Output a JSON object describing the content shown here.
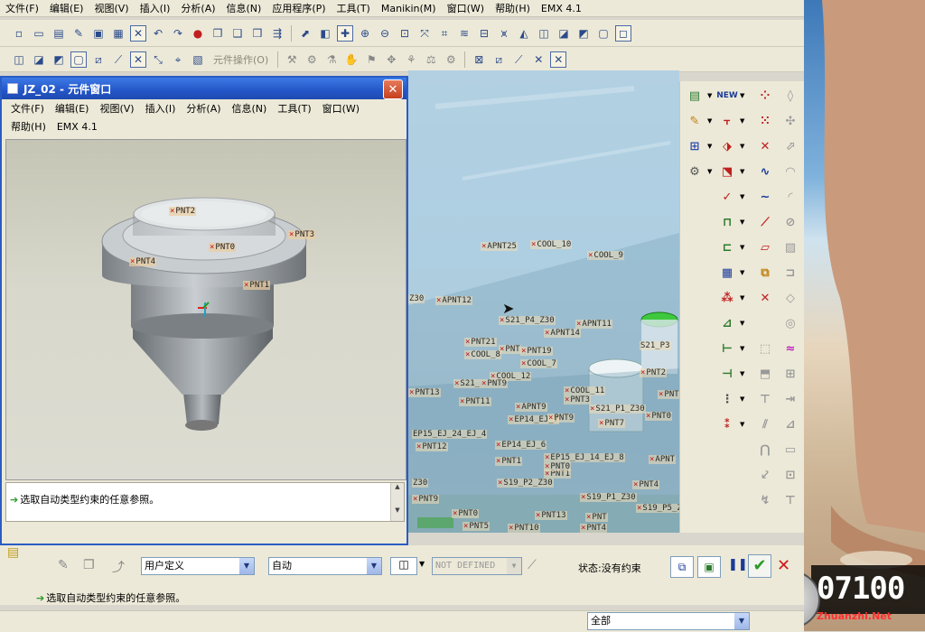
{
  "main_menu": [
    "文件(F)",
    "编辑(E)",
    "视图(V)",
    "插入(I)",
    "分析(A)",
    "信息(N)",
    "应用程序(P)",
    "工具(T)",
    "Manikin(M)",
    "窗口(W)",
    "帮助(H)",
    "EMX 4.1"
  ],
  "toolbar2_label": "元件操作(O)",
  "component_window": {
    "title": "JZ_02 - 元件窗口",
    "menu_row1": [
      "文件(F)",
      "编辑(E)",
      "视图(V)",
      "插入(I)",
      "分析(A)",
      "信息(N)",
      "工具(T)",
      "窗口(W)"
    ],
    "menu_row2": [
      "帮助(H)",
      "EMX 4.1"
    ],
    "points": [
      "PNT2",
      "PNT3",
      "PNT0",
      "PNT4",
      "PNT1"
    ],
    "message": "选取自动类型约束的任意参照。"
  },
  "viewport_labels": [
    "APNT25",
    "COOL_10",
    "COOL_9",
    "APNT12",
    "Z30",
    "S21_P4_Z30",
    "APNT11",
    "APNT14",
    "S21_P3",
    "PNT21",
    "PNT",
    "PNT19",
    "COOL_8",
    "COOL_7",
    "PNT2",
    "COOL_12",
    "S21_",
    "PNT9",
    "PNT13",
    "PNT11",
    "COOL_11",
    "PNT",
    "APNT9",
    "PNT3",
    "S21_P1_Z30",
    "EP14_EJ_7",
    "PNT9",
    "PNT7",
    "PNT0",
    "EP15_EJ_24_EJ_4",
    "PNT12",
    "EP14_EJ_6",
    "EP15_EJ_14_EJ_8",
    "APNT",
    "PNT1",
    "PNT1",
    "PNT0",
    "Z30",
    "S19_P2_Z30",
    "PNT4",
    "PNT9",
    "S19_P1_Z30",
    "PNT0",
    "PNT13",
    "PNT",
    "S19_P5_Z",
    "PNT5",
    "PNT10",
    "PNT4"
  ],
  "dashboard": {
    "constraint_set": "用户定义",
    "constraint_type": "自动",
    "offset": "NOT DEFINED",
    "status": "状态:没有约束"
  },
  "status_message": "选取自动类型约束的任意参照。",
  "filter": "全部",
  "watermark": {
    "number": "07100",
    "site": "Zhuanzhi.Net"
  },
  "colors": {
    "title_blue": "#2456c8",
    "accent_green": "#2a9a2a",
    "cancel_red": "#d01a1a"
  }
}
